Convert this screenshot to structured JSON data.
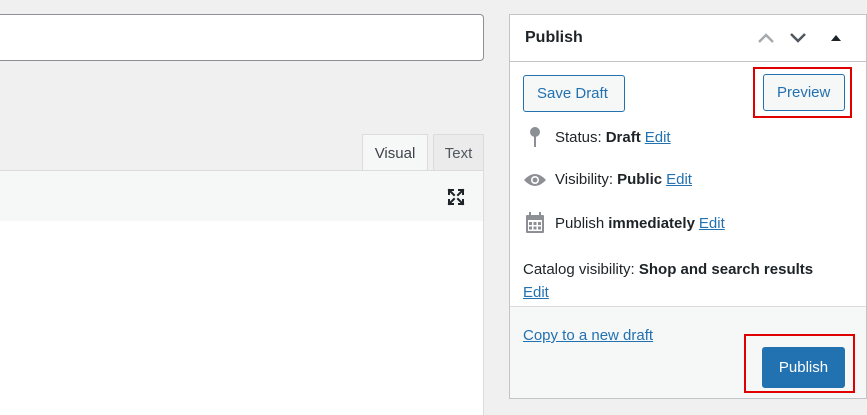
{
  "editor": {
    "title_value": "",
    "tabs": [
      {
        "label": "Visual"
      },
      {
        "label": "Text"
      }
    ]
  },
  "publish": {
    "title": "Publish",
    "save_draft_label": "Save Draft",
    "preview_label": "Preview",
    "status": {
      "label": "Status:",
      "value": "Draft",
      "edit": "Edit"
    },
    "visibility": {
      "label": "Visibility:",
      "value": "Public",
      "edit": "Edit"
    },
    "schedule": {
      "label": "Publish",
      "value": "immediately",
      "edit": "Edit"
    },
    "catalog": {
      "label": "Catalog visibility:",
      "value": "Shop and search results",
      "edit": "Edit"
    },
    "copy_draft_label": "Copy to a new draft",
    "publish_label": "Publish"
  },
  "colors": {
    "accent": "#2271b1",
    "highlight": "#e00000"
  },
  "icons": [
    "fullscreen-icon",
    "chevron-up-icon",
    "chevron-down-icon",
    "toggle-arrow-icon",
    "pin-icon",
    "eye-icon",
    "calendar-icon"
  ]
}
